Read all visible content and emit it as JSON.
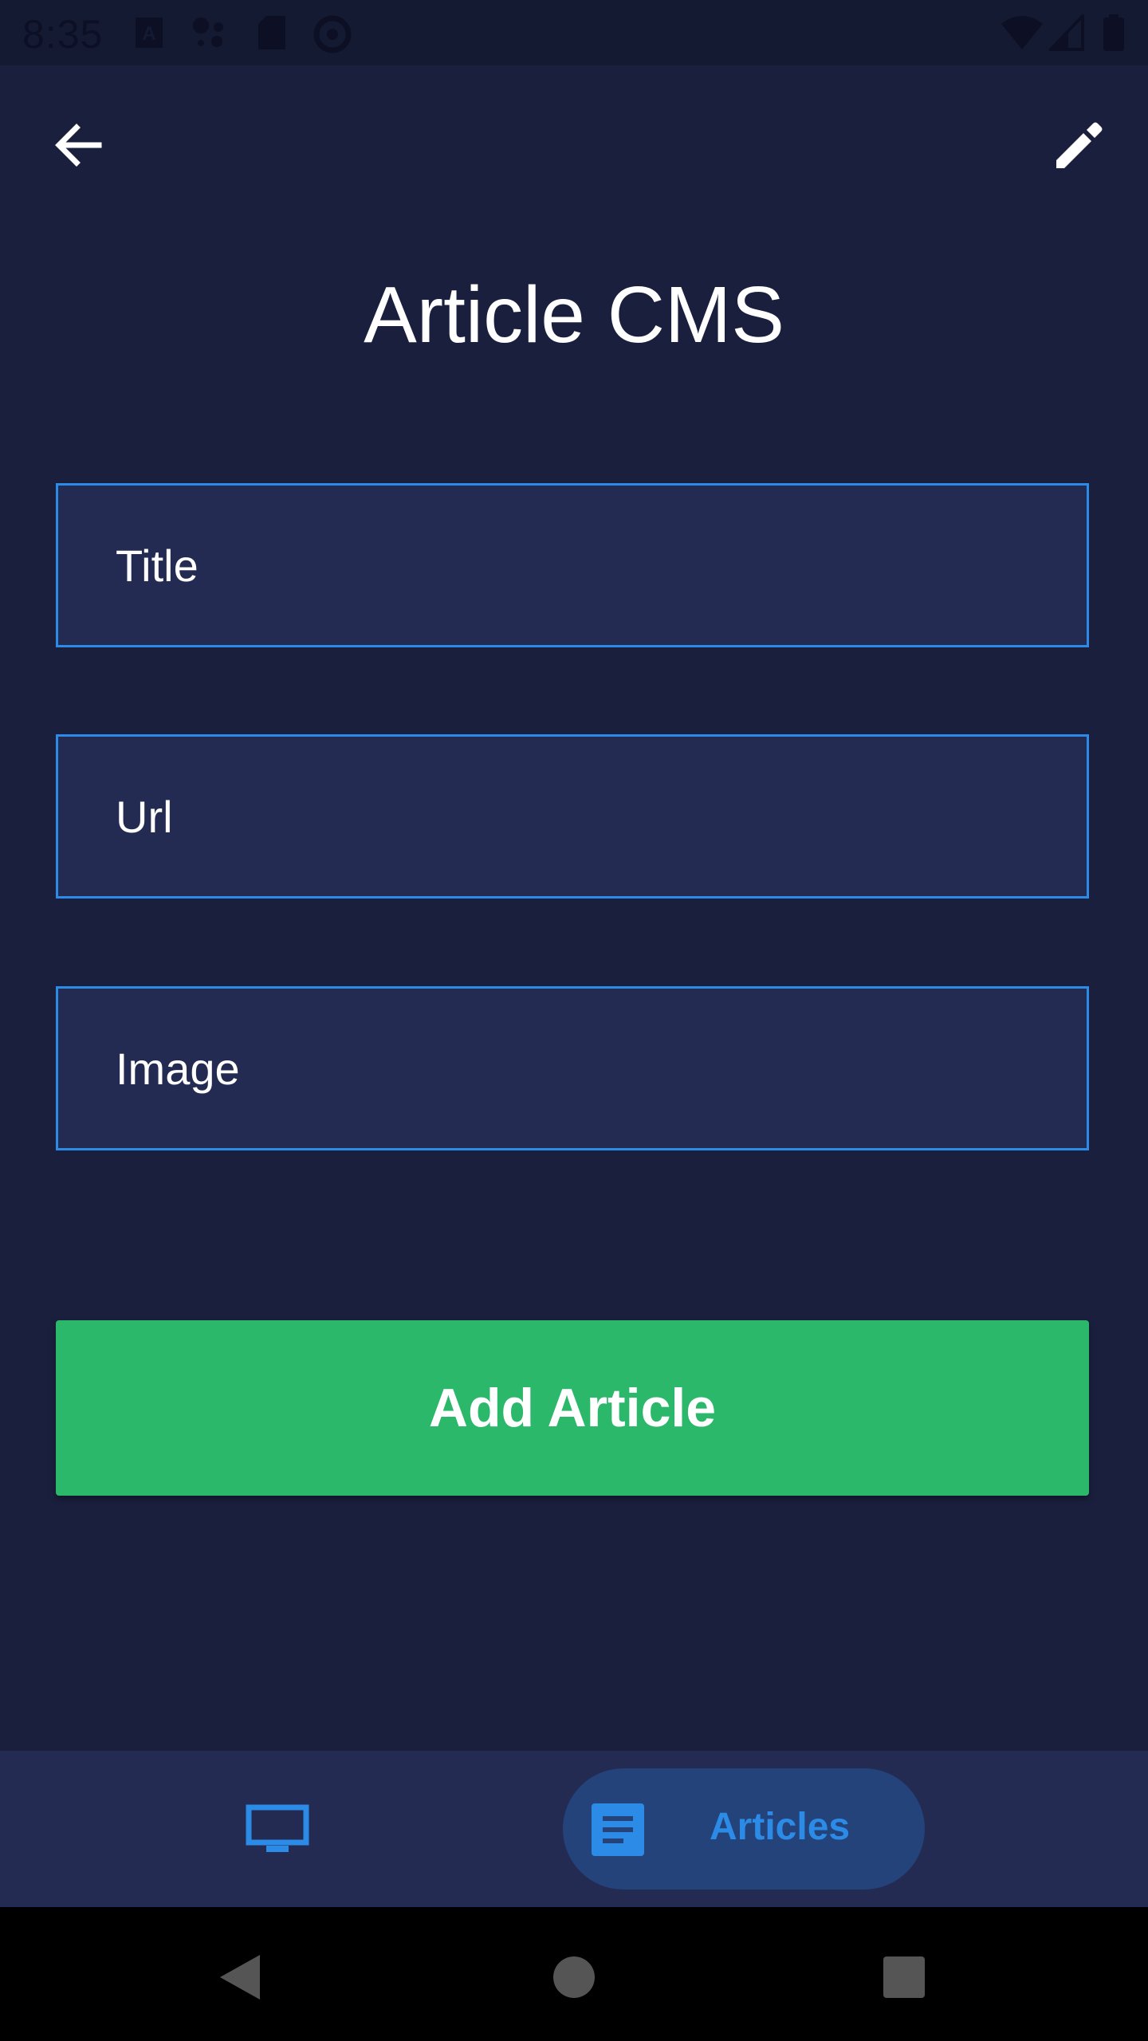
{
  "status_bar": {
    "time": "8:35"
  },
  "app_bar": {
    "back_icon": "arrow-left-icon",
    "edit_icon": "pencil-icon"
  },
  "page": {
    "title": "Article CMS"
  },
  "form": {
    "title_placeholder": "Title",
    "url_placeholder": "Url",
    "image_placeholder": "Image",
    "submit_label": "Add Article"
  },
  "bottom_nav": {
    "items": [
      {
        "icon": "monitor-icon",
        "label": ""
      },
      {
        "icon": "article-icon",
        "label": "Articles"
      }
    ],
    "active_index": 1
  },
  "colors": {
    "background": "#1a1f3d",
    "field_bg": "#232b52",
    "accent": "#2b8be6",
    "button_green": "#2bb86a",
    "nav_pill": "#23437a"
  }
}
